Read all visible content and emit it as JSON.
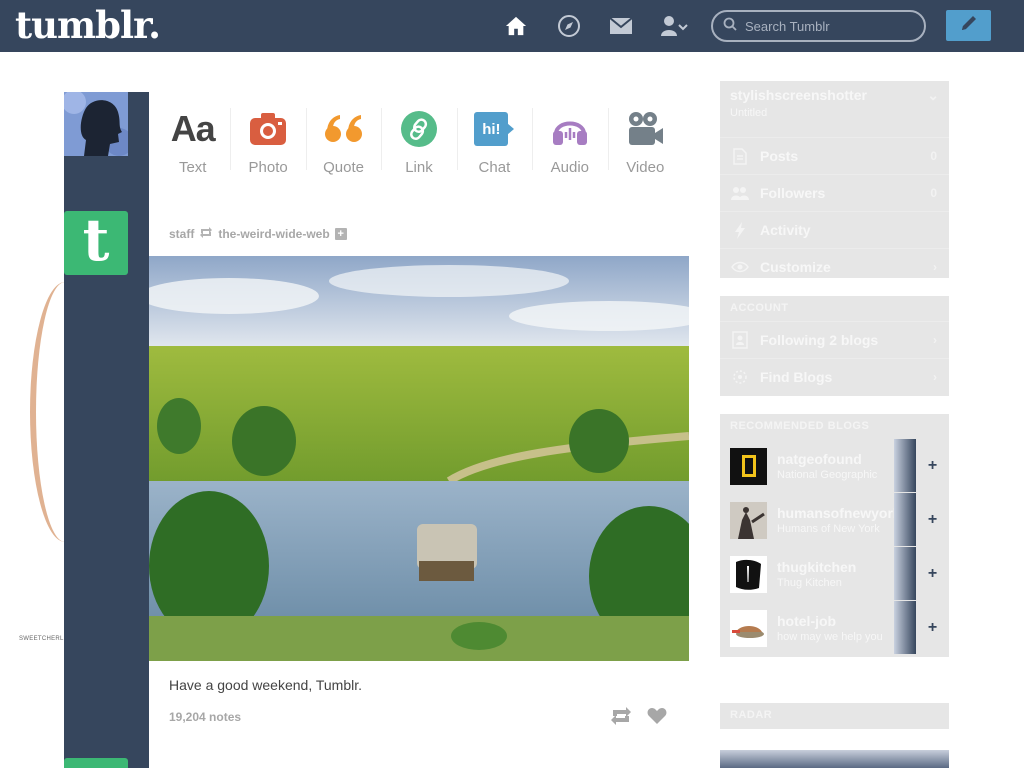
{
  "topbar": {
    "logo": "tumblr.",
    "search_placeholder": "Search Tumblr",
    "icons": [
      "home-icon",
      "explore-compass-icon",
      "inbox-mail-icon",
      "account-icon",
      "compose-pencil-icon"
    ]
  },
  "background": {
    "credit": "SWEETCHERL"
  },
  "post_types": [
    {
      "label": "Text",
      "glyph": "Aa",
      "color": "#444444"
    },
    {
      "label": "Photo",
      "color": "#d95e40"
    },
    {
      "label": "Quote",
      "color": "#f2992e"
    },
    {
      "label": "Link",
      "color": "#56bc8a"
    },
    {
      "label": "Chat",
      "glyph": "hi!",
      "color": "#529ecc"
    },
    {
      "label": "Audio",
      "color": "#a77dc2"
    },
    {
      "label": "Video",
      "color": "#748089"
    }
  ],
  "post": {
    "author": "staff",
    "reblogged_from": "the-weird-wide-web",
    "follow_glyph": "+",
    "avatar_glyph": "t",
    "caption": "Have a good weekend, Tumblr.",
    "notes": "19,204 notes"
  },
  "sidebar": {
    "blog": {
      "name": "stylishscreenshotter",
      "subtitle": "Untitled",
      "rows": [
        {
          "label": "Posts",
          "meta": "0",
          "icon": "posts-icon"
        },
        {
          "label": "Followers",
          "meta": "0",
          "icon": "followers-icon"
        },
        {
          "label": "Activity",
          "meta": "",
          "icon": "activity-bolt-icon"
        },
        {
          "label": "Customize",
          "meta": "›",
          "icon": "customize-eye-icon"
        }
      ]
    },
    "account": {
      "heading": "ACCOUNT",
      "rows": [
        {
          "label": "Following 2 blogs",
          "meta": "›",
          "icon": "following-icon"
        },
        {
          "label": "Find Blogs",
          "meta": "›",
          "icon": "find-blogs-icon"
        }
      ]
    },
    "recommended": {
      "heading": "RECOMMENDED BLOGS",
      "follow_glyph": "+",
      "items": [
        {
          "name": "natgeofound",
          "subtitle": "National Geographic"
        },
        {
          "name": "humansofnewyork",
          "subtitle": "Humans of New York"
        },
        {
          "name": "thugkitchen",
          "subtitle": "Thug Kitchen"
        },
        {
          "name": "hotel-job",
          "subtitle": "how may we help you"
        }
      ]
    },
    "radar": {
      "heading": "RADAR"
    }
  },
  "colors": {
    "navy": "#36465d",
    "accent_blue": "#529ecc",
    "tumblr_green": "#3cb874"
  }
}
